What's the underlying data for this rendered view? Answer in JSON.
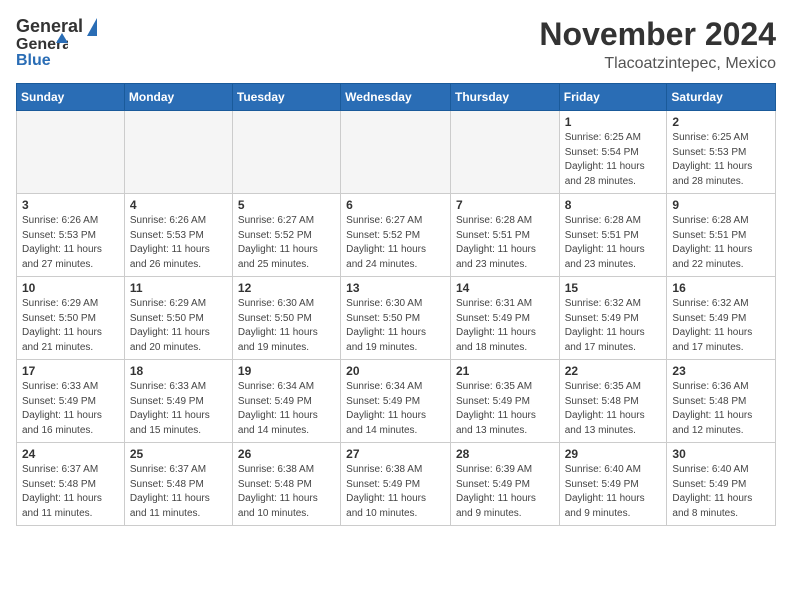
{
  "header": {
    "logo_general": "General",
    "logo_blue": "Blue",
    "month_title": "November 2024",
    "location": "Tlacoatzintepec, Mexico"
  },
  "calendar": {
    "days_of_week": [
      "Sunday",
      "Monday",
      "Tuesday",
      "Wednesday",
      "Thursday",
      "Friday",
      "Saturday"
    ],
    "weeks": [
      [
        {
          "day": "",
          "info": ""
        },
        {
          "day": "",
          "info": ""
        },
        {
          "day": "",
          "info": ""
        },
        {
          "day": "",
          "info": ""
        },
        {
          "day": "",
          "info": ""
        },
        {
          "day": "1",
          "info": "Sunrise: 6:25 AM\nSunset: 5:54 PM\nDaylight: 11 hours and 28 minutes."
        },
        {
          "day": "2",
          "info": "Sunrise: 6:25 AM\nSunset: 5:53 PM\nDaylight: 11 hours and 28 minutes."
        }
      ],
      [
        {
          "day": "3",
          "info": "Sunrise: 6:26 AM\nSunset: 5:53 PM\nDaylight: 11 hours and 27 minutes."
        },
        {
          "day": "4",
          "info": "Sunrise: 6:26 AM\nSunset: 5:53 PM\nDaylight: 11 hours and 26 minutes."
        },
        {
          "day": "5",
          "info": "Sunrise: 6:27 AM\nSunset: 5:52 PM\nDaylight: 11 hours and 25 minutes."
        },
        {
          "day": "6",
          "info": "Sunrise: 6:27 AM\nSunset: 5:52 PM\nDaylight: 11 hours and 24 minutes."
        },
        {
          "day": "7",
          "info": "Sunrise: 6:28 AM\nSunset: 5:51 PM\nDaylight: 11 hours and 23 minutes."
        },
        {
          "day": "8",
          "info": "Sunrise: 6:28 AM\nSunset: 5:51 PM\nDaylight: 11 hours and 23 minutes."
        },
        {
          "day": "9",
          "info": "Sunrise: 6:28 AM\nSunset: 5:51 PM\nDaylight: 11 hours and 22 minutes."
        }
      ],
      [
        {
          "day": "10",
          "info": "Sunrise: 6:29 AM\nSunset: 5:50 PM\nDaylight: 11 hours and 21 minutes."
        },
        {
          "day": "11",
          "info": "Sunrise: 6:29 AM\nSunset: 5:50 PM\nDaylight: 11 hours and 20 minutes."
        },
        {
          "day": "12",
          "info": "Sunrise: 6:30 AM\nSunset: 5:50 PM\nDaylight: 11 hours and 19 minutes."
        },
        {
          "day": "13",
          "info": "Sunrise: 6:30 AM\nSunset: 5:50 PM\nDaylight: 11 hours and 19 minutes."
        },
        {
          "day": "14",
          "info": "Sunrise: 6:31 AM\nSunset: 5:49 PM\nDaylight: 11 hours and 18 minutes."
        },
        {
          "day": "15",
          "info": "Sunrise: 6:32 AM\nSunset: 5:49 PM\nDaylight: 11 hours and 17 minutes."
        },
        {
          "day": "16",
          "info": "Sunrise: 6:32 AM\nSunset: 5:49 PM\nDaylight: 11 hours and 17 minutes."
        }
      ],
      [
        {
          "day": "17",
          "info": "Sunrise: 6:33 AM\nSunset: 5:49 PM\nDaylight: 11 hours and 16 minutes."
        },
        {
          "day": "18",
          "info": "Sunrise: 6:33 AM\nSunset: 5:49 PM\nDaylight: 11 hours and 15 minutes."
        },
        {
          "day": "19",
          "info": "Sunrise: 6:34 AM\nSunset: 5:49 PM\nDaylight: 11 hours and 14 minutes."
        },
        {
          "day": "20",
          "info": "Sunrise: 6:34 AM\nSunset: 5:49 PM\nDaylight: 11 hours and 14 minutes."
        },
        {
          "day": "21",
          "info": "Sunrise: 6:35 AM\nSunset: 5:49 PM\nDaylight: 11 hours and 13 minutes."
        },
        {
          "day": "22",
          "info": "Sunrise: 6:35 AM\nSunset: 5:48 PM\nDaylight: 11 hours and 13 minutes."
        },
        {
          "day": "23",
          "info": "Sunrise: 6:36 AM\nSunset: 5:48 PM\nDaylight: 11 hours and 12 minutes."
        }
      ],
      [
        {
          "day": "24",
          "info": "Sunrise: 6:37 AM\nSunset: 5:48 PM\nDaylight: 11 hours and 11 minutes."
        },
        {
          "day": "25",
          "info": "Sunrise: 6:37 AM\nSunset: 5:48 PM\nDaylight: 11 hours and 11 minutes."
        },
        {
          "day": "26",
          "info": "Sunrise: 6:38 AM\nSunset: 5:48 PM\nDaylight: 11 hours and 10 minutes."
        },
        {
          "day": "27",
          "info": "Sunrise: 6:38 AM\nSunset: 5:49 PM\nDaylight: 11 hours and 10 minutes."
        },
        {
          "day": "28",
          "info": "Sunrise: 6:39 AM\nSunset: 5:49 PM\nDaylight: 11 hours and 9 minutes."
        },
        {
          "day": "29",
          "info": "Sunrise: 6:40 AM\nSunset: 5:49 PM\nDaylight: 11 hours and 9 minutes."
        },
        {
          "day": "30",
          "info": "Sunrise: 6:40 AM\nSunset: 5:49 PM\nDaylight: 11 hours and 8 minutes."
        }
      ]
    ]
  }
}
